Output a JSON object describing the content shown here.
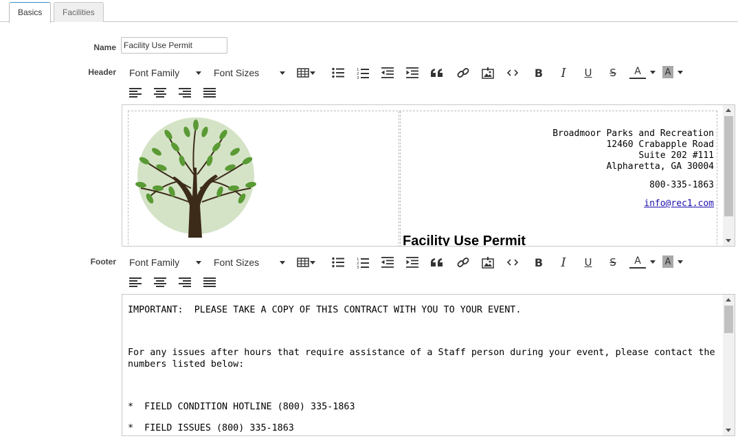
{
  "tabs": [
    {
      "label": "Basics",
      "active": true
    },
    {
      "label": "Facilities",
      "active": false
    }
  ],
  "form": {
    "name_label": "Name",
    "name_value": "Facility Use Permit",
    "header_label": "Header",
    "footer_label": "Footer"
  },
  "toolbar": {
    "font_family": "Font Family",
    "font_sizes": "Font Sizes",
    "buttons": [
      "table-icon",
      "bullet-list-icon",
      "numbered-list-icon",
      "outdent-icon",
      "indent-icon",
      "blockquote-icon",
      "link-icon",
      "image-icon",
      "code-icon",
      "bold-icon",
      "italic-icon",
      "underline-icon",
      "strikethrough-icon",
      "font-color-icon",
      "highlight-color-icon",
      "align-left-icon",
      "align-center-icon",
      "align-right-icon",
      "align-justify-icon"
    ],
    "font_color_letter": "A",
    "highlight_letter": "A",
    "bold_letter": "B",
    "italic_letter": "I",
    "underline_letter": "U",
    "strike_letter": "S"
  },
  "header_content": {
    "address_lines": [
      "Broadmoor Parks and Recreation",
      "12460 Crabapple Road",
      "Suite 202 #111",
      "Alpharetta, GA 30004"
    ],
    "phone": "800-335-1863",
    "email": "info@rec1.com",
    "permit_title": "Facility Use Permit",
    "logo": "tree-logo"
  },
  "footer_content": {
    "line1": "IMPORTANT:  PLEASE TAKE A COPY OF THIS CONTRACT WITH YOU TO YOUR EVENT.",
    "line2": "For any issues after hours that require assistance of a Staff person during your event, please contact the numbers listed below:",
    "line3": "*  FIELD CONDITION HOTLINE (800) 335-1863",
    "line4": "*  FIELD ISSUES (800) 335-1863"
  },
  "colors": {
    "active_tab_accent": "#3a8fc7",
    "link": "#1a0dab",
    "tree_circle": "#d4e3c6",
    "leaf": "#5a9a35",
    "trunk": "#3d2b1a"
  }
}
